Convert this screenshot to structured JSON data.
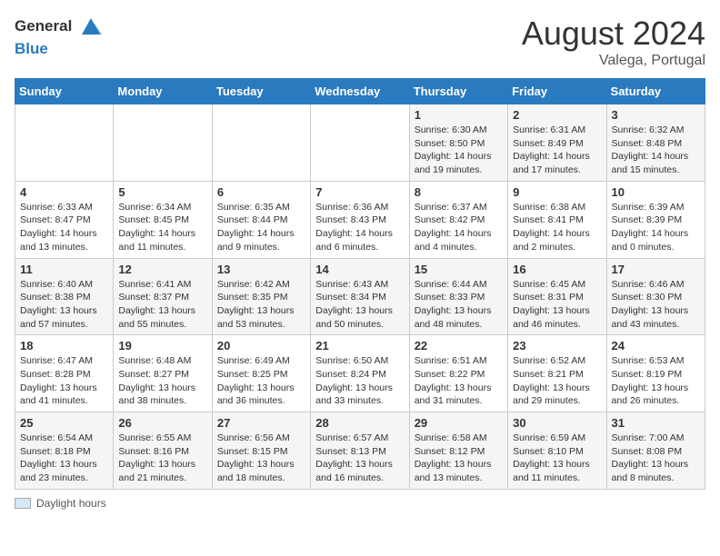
{
  "header": {
    "logo_line1": "General",
    "logo_line2": "Blue",
    "month_title": "August 2024",
    "location": "Valega, Portugal"
  },
  "days_of_week": [
    "Sunday",
    "Monday",
    "Tuesday",
    "Wednesday",
    "Thursday",
    "Friday",
    "Saturday"
  ],
  "legend_label": "Daylight hours",
  "weeks": [
    [
      {
        "day": "",
        "info": ""
      },
      {
        "day": "",
        "info": ""
      },
      {
        "day": "",
        "info": ""
      },
      {
        "day": "",
        "info": ""
      },
      {
        "day": "1",
        "info": "Sunrise: 6:30 AM\nSunset: 8:50 PM\nDaylight: 14 hours\nand 19 minutes."
      },
      {
        "day": "2",
        "info": "Sunrise: 6:31 AM\nSunset: 8:49 PM\nDaylight: 14 hours\nand 17 minutes."
      },
      {
        "day": "3",
        "info": "Sunrise: 6:32 AM\nSunset: 8:48 PM\nDaylight: 14 hours\nand 15 minutes."
      }
    ],
    [
      {
        "day": "4",
        "info": "Sunrise: 6:33 AM\nSunset: 8:47 PM\nDaylight: 14 hours\nand 13 minutes."
      },
      {
        "day": "5",
        "info": "Sunrise: 6:34 AM\nSunset: 8:45 PM\nDaylight: 14 hours\nand 11 minutes."
      },
      {
        "day": "6",
        "info": "Sunrise: 6:35 AM\nSunset: 8:44 PM\nDaylight: 14 hours\nand 9 minutes."
      },
      {
        "day": "7",
        "info": "Sunrise: 6:36 AM\nSunset: 8:43 PM\nDaylight: 14 hours\nand 6 minutes."
      },
      {
        "day": "8",
        "info": "Sunrise: 6:37 AM\nSunset: 8:42 PM\nDaylight: 14 hours\nand 4 minutes."
      },
      {
        "day": "9",
        "info": "Sunrise: 6:38 AM\nSunset: 8:41 PM\nDaylight: 14 hours\nand 2 minutes."
      },
      {
        "day": "10",
        "info": "Sunrise: 6:39 AM\nSunset: 8:39 PM\nDaylight: 14 hours\nand 0 minutes."
      }
    ],
    [
      {
        "day": "11",
        "info": "Sunrise: 6:40 AM\nSunset: 8:38 PM\nDaylight: 13 hours\nand 57 minutes."
      },
      {
        "day": "12",
        "info": "Sunrise: 6:41 AM\nSunset: 8:37 PM\nDaylight: 13 hours\nand 55 minutes."
      },
      {
        "day": "13",
        "info": "Sunrise: 6:42 AM\nSunset: 8:35 PM\nDaylight: 13 hours\nand 53 minutes."
      },
      {
        "day": "14",
        "info": "Sunrise: 6:43 AM\nSunset: 8:34 PM\nDaylight: 13 hours\nand 50 minutes."
      },
      {
        "day": "15",
        "info": "Sunrise: 6:44 AM\nSunset: 8:33 PM\nDaylight: 13 hours\nand 48 minutes."
      },
      {
        "day": "16",
        "info": "Sunrise: 6:45 AM\nSunset: 8:31 PM\nDaylight: 13 hours\nand 46 minutes."
      },
      {
        "day": "17",
        "info": "Sunrise: 6:46 AM\nSunset: 8:30 PM\nDaylight: 13 hours\nand 43 minutes."
      }
    ],
    [
      {
        "day": "18",
        "info": "Sunrise: 6:47 AM\nSunset: 8:28 PM\nDaylight: 13 hours\nand 41 minutes."
      },
      {
        "day": "19",
        "info": "Sunrise: 6:48 AM\nSunset: 8:27 PM\nDaylight: 13 hours\nand 38 minutes."
      },
      {
        "day": "20",
        "info": "Sunrise: 6:49 AM\nSunset: 8:25 PM\nDaylight: 13 hours\nand 36 minutes."
      },
      {
        "day": "21",
        "info": "Sunrise: 6:50 AM\nSunset: 8:24 PM\nDaylight: 13 hours\nand 33 minutes."
      },
      {
        "day": "22",
        "info": "Sunrise: 6:51 AM\nSunset: 8:22 PM\nDaylight: 13 hours\nand 31 minutes."
      },
      {
        "day": "23",
        "info": "Sunrise: 6:52 AM\nSunset: 8:21 PM\nDaylight: 13 hours\nand 29 minutes."
      },
      {
        "day": "24",
        "info": "Sunrise: 6:53 AM\nSunset: 8:19 PM\nDaylight: 13 hours\nand 26 minutes."
      }
    ],
    [
      {
        "day": "25",
        "info": "Sunrise: 6:54 AM\nSunset: 8:18 PM\nDaylight: 13 hours\nand 23 minutes."
      },
      {
        "day": "26",
        "info": "Sunrise: 6:55 AM\nSunset: 8:16 PM\nDaylight: 13 hours\nand 21 minutes."
      },
      {
        "day": "27",
        "info": "Sunrise: 6:56 AM\nSunset: 8:15 PM\nDaylight: 13 hours\nand 18 minutes."
      },
      {
        "day": "28",
        "info": "Sunrise: 6:57 AM\nSunset: 8:13 PM\nDaylight: 13 hours\nand 16 minutes."
      },
      {
        "day": "29",
        "info": "Sunrise: 6:58 AM\nSunset: 8:12 PM\nDaylight: 13 hours\nand 13 minutes."
      },
      {
        "day": "30",
        "info": "Sunrise: 6:59 AM\nSunset: 8:10 PM\nDaylight: 13 hours\nand 11 minutes."
      },
      {
        "day": "31",
        "info": "Sunrise: 7:00 AM\nSunset: 8:08 PM\nDaylight: 13 hours\nand 8 minutes."
      }
    ]
  ]
}
